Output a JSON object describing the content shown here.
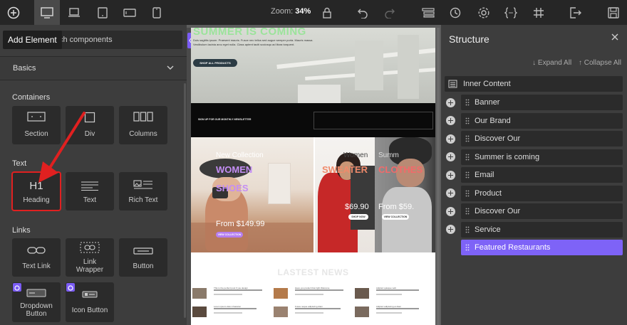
{
  "toolbar": {
    "add_icon": "plus-circle-icon",
    "devices": [
      "desktop-icon",
      "laptop-icon",
      "tablet-icon",
      "tablet-landscape-icon",
      "mobile-icon"
    ],
    "zoom_label": "Zoom:",
    "zoom_value": "34%",
    "tools": [
      "lock-icon",
      "undo-icon",
      "redo-icon",
      "stack-icon",
      "history-icon",
      "settings-icon",
      "code-icon",
      "grid-icon",
      "exit-icon",
      "save-icon"
    ]
  },
  "left_panel": {
    "tooltip": "Add Element",
    "search_placeholder": "ch components",
    "section_title": "Basics",
    "groups": {
      "containers": "Containers",
      "text": "Text",
      "links": "Links"
    },
    "tiles": {
      "section": "Section",
      "div": "Div",
      "columns": "Columns",
      "heading": "Heading",
      "heading_glyph": "H1",
      "text": "Text",
      "rich_text": "Rich Text",
      "text_link": "Text Link",
      "link_wrapper": "Link Wrapper",
      "button": "Button",
      "dropdown_button": "Dropdown Button",
      "icon_button": "Icon Button"
    },
    "accent": "#7b5cf5",
    "highlight_color": "#e02020"
  },
  "canvas": {
    "hero_title": "SUMMER IS COMING",
    "hero_text": "Duis sagittis ipsum. Praesent mauris. Fusce nec tellus sed augue semper porta. Mauris massa. Vestibulum lacinia arcu eget nulla. Class aptent taciti sociosqu ad litora torquent.",
    "hero_button": "SHOP ALL PRODUCTS",
    "signup_text": "SIGN UP FOR OUR MONTHLY NEWSLETTER",
    "promo1": {
      "line1": "New Collection",
      "line2": "WOMEN",
      "line3": "SHOES",
      "price": "From $149.99",
      "cta": "VIEW COLLECTION"
    },
    "promo2": {
      "line1": "Women",
      "line2": "SWEATER",
      "price": "$69.90",
      "cta": "SHOP NOW"
    },
    "promo3": {
      "line1": "Summ",
      "line2": "CLOTHES",
      "price": "From $59.",
      "cta": "VIEW COLLECTION"
    },
    "news_title": "LASTEST NEWS",
    "news_items": [
      "This is the perfect post if you design",
      "Have you prefect that right Welcome",
      "Adipisci quisque velit",
      "Lorem ipsum dolor character",
      "Fusce neque adipiscing diam",
      "Adipisci adipiscing et diam"
    ]
  },
  "structure": {
    "title": "Structure",
    "expand_all": "↓ Expand All",
    "collapse_all": "↑ Collapse All",
    "root": "Inner Content",
    "children": [
      "Banner",
      "Our Brand",
      "Discover Our",
      "Summer is coming",
      "Email",
      "Product",
      "Discover Our",
      "Service"
    ],
    "selected": "Featured Restaurants",
    "active_color": "#7e63f7"
  }
}
